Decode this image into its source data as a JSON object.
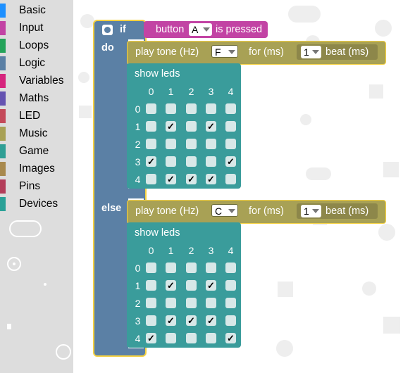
{
  "toolbox": {
    "categories": [
      {
        "label": "Basic",
        "color": "#1e90ff"
      },
      {
        "label": "Input",
        "color": "#c243a4"
      },
      {
        "label": "Loops",
        "color": "#24a35a"
      },
      {
        "label": "Logic",
        "color": "#5b80a5"
      },
      {
        "label": "Variables",
        "color": "#d6257d"
      },
      {
        "label": "Maths",
        "color": "#6553b1"
      },
      {
        "label": "LED",
        "color": "#c44a5a"
      },
      {
        "label": "Music",
        "color": "#a8a155"
      },
      {
        "label": "Game",
        "color": "#2f9f95"
      },
      {
        "label": "Images",
        "color": "#a8894d"
      },
      {
        "label": "Pins",
        "color": "#b33e5a"
      },
      {
        "label": "Devices",
        "color": "#2aa197"
      }
    ]
  },
  "if_block": {
    "if_label": "if",
    "do_label": "do",
    "else_label": "else",
    "condition": {
      "prefix": "button",
      "button": "A",
      "suffix": "is pressed"
    }
  },
  "then": {
    "tone": {
      "label": "play tone (Hz)",
      "note": "F",
      "for_label": "for (ms)",
      "beat": "1",
      "beat_suffix": "beat (ms)"
    },
    "leds": {
      "label": "show leds",
      "cols": [
        "0",
        "1",
        "2",
        "3",
        "4"
      ],
      "rows": [
        "0",
        "1",
        "2",
        "3",
        "4"
      ],
      "grid": [
        [
          0,
          0,
          0,
          0,
          0
        ],
        [
          0,
          1,
          0,
          1,
          0
        ],
        [
          0,
          0,
          0,
          0,
          0
        ],
        [
          1,
          0,
          0,
          0,
          1
        ],
        [
          0,
          1,
          1,
          1,
          0
        ]
      ]
    }
  },
  "else": {
    "tone": {
      "label": "play tone (Hz)",
      "note": "C",
      "for_label": "for (ms)",
      "beat": "1",
      "beat_suffix": "beat (ms)"
    },
    "leds": {
      "label": "show leds",
      "cols": [
        "0",
        "1",
        "2",
        "3",
        "4"
      ],
      "rows": [
        "0",
        "1",
        "2",
        "3",
        "4"
      ],
      "grid": [
        [
          0,
          0,
          0,
          0,
          0
        ],
        [
          0,
          1,
          0,
          1,
          0
        ],
        [
          0,
          0,
          0,
          0,
          0
        ],
        [
          0,
          1,
          1,
          1,
          0
        ],
        [
          1,
          0,
          0,
          0,
          1
        ]
      ]
    }
  },
  "colors": {
    "logic": "#5b80a5",
    "input": "#c243a4",
    "music": "#a8a155",
    "led": "#3a9c9b",
    "selected": "#f5d142"
  }
}
